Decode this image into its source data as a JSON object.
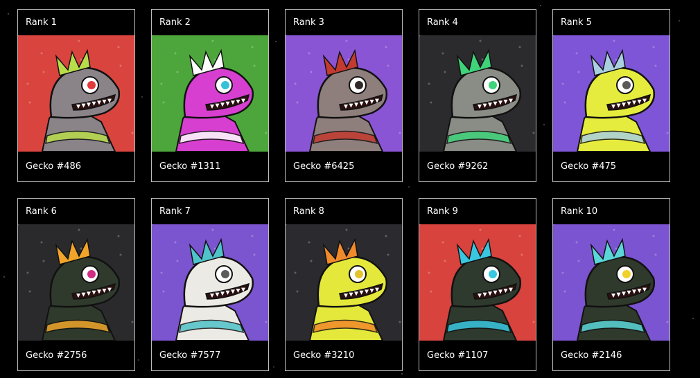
{
  "gallery": {
    "items": [
      {
        "rank": "Rank 1",
        "name": "Gecko #486",
        "bg": "#d9443f",
        "skin": "#8a8489",
        "accent": "#b9dd4a",
        "eye": "#e13a3a",
        "icon": "gecko-486-art"
      },
      {
        "rank": "Rank 2",
        "name": "Gecko #1311",
        "bg": "#4da63b",
        "skin": "#d63fd0",
        "accent": "#ffffff",
        "eye": "#37c0d8",
        "icon": "gecko-1311-art"
      },
      {
        "rank": "Rank 3",
        "name": "Gecko #6425",
        "bg": "#8a55d4",
        "skin": "#8f7f7c",
        "accent": "#c33a2f",
        "eye": "#2f2a28",
        "icon": "gecko-6425-art"
      },
      {
        "rank": "Rank 4",
        "name": "Gecko #9262",
        "bg": "#2b2a2d",
        "skin": "#8a8c86",
        "accent": "#3fd37a",
        "eye": "#3fd37a",
        "icon": "gecko-9262-art"
      },
      {
        "rank": "Rank 5",
        "name": "Gecko #475",
        "bg": "#7d55d6",
        "skin": "#e6ec3d",
        "accent": "#a9cfe0",
        "eye": "#5a5a5a",
        "icon": "gecko-475-art"
      },
      {
        "rank": "Rank 6",
        "name": "Gecko #2756",
        "bg": "#2a2a2d",
        "skin": "#2f3a2c",
        "accent": "#f0a52a",
        "eye": "#d12e83",
        "icon": "gecko-2756-art"
      },
      {
        "rank": "Rank 7",
        "name": "Gecko #7577",
        "bg": "#7b54cf",
        "skin": "#eceae4",
        "accent": "#4fc3c9",
        "eye": "#5b5b5b",
        "icon": "gecko-7577-art"
      },
      {
        "rank": "Rank 8",
        "name": "Gecko #3210",
        "bg": "#2b2a2e",
        "skin": "#e4e83a",
        "accent": "#f08a2a",
        "eye": "#e4c32b",
        "icon": "gecko-3210-art"
      },
      {
        "rank": "Rank 9",
        "name": "Gecko #1107",
        "bg": "#d8433d",
        "skin": "#2e3a2d",
        "accent": "#39c6e0",
        "eye": "#39c6e0",
        "icon": "gecko-1107-art"
      },
      {
        "rank": "Rank 10",
        "name": "Gecko #2146",
        "bg": "#7b54d1",
        "skin": "#2f3a2c",
        "accent": "#5bd6d8",
        "eye": "#f0d12a",
        "icon": "gecko-2146-art"
      }
    ]
  }
}
